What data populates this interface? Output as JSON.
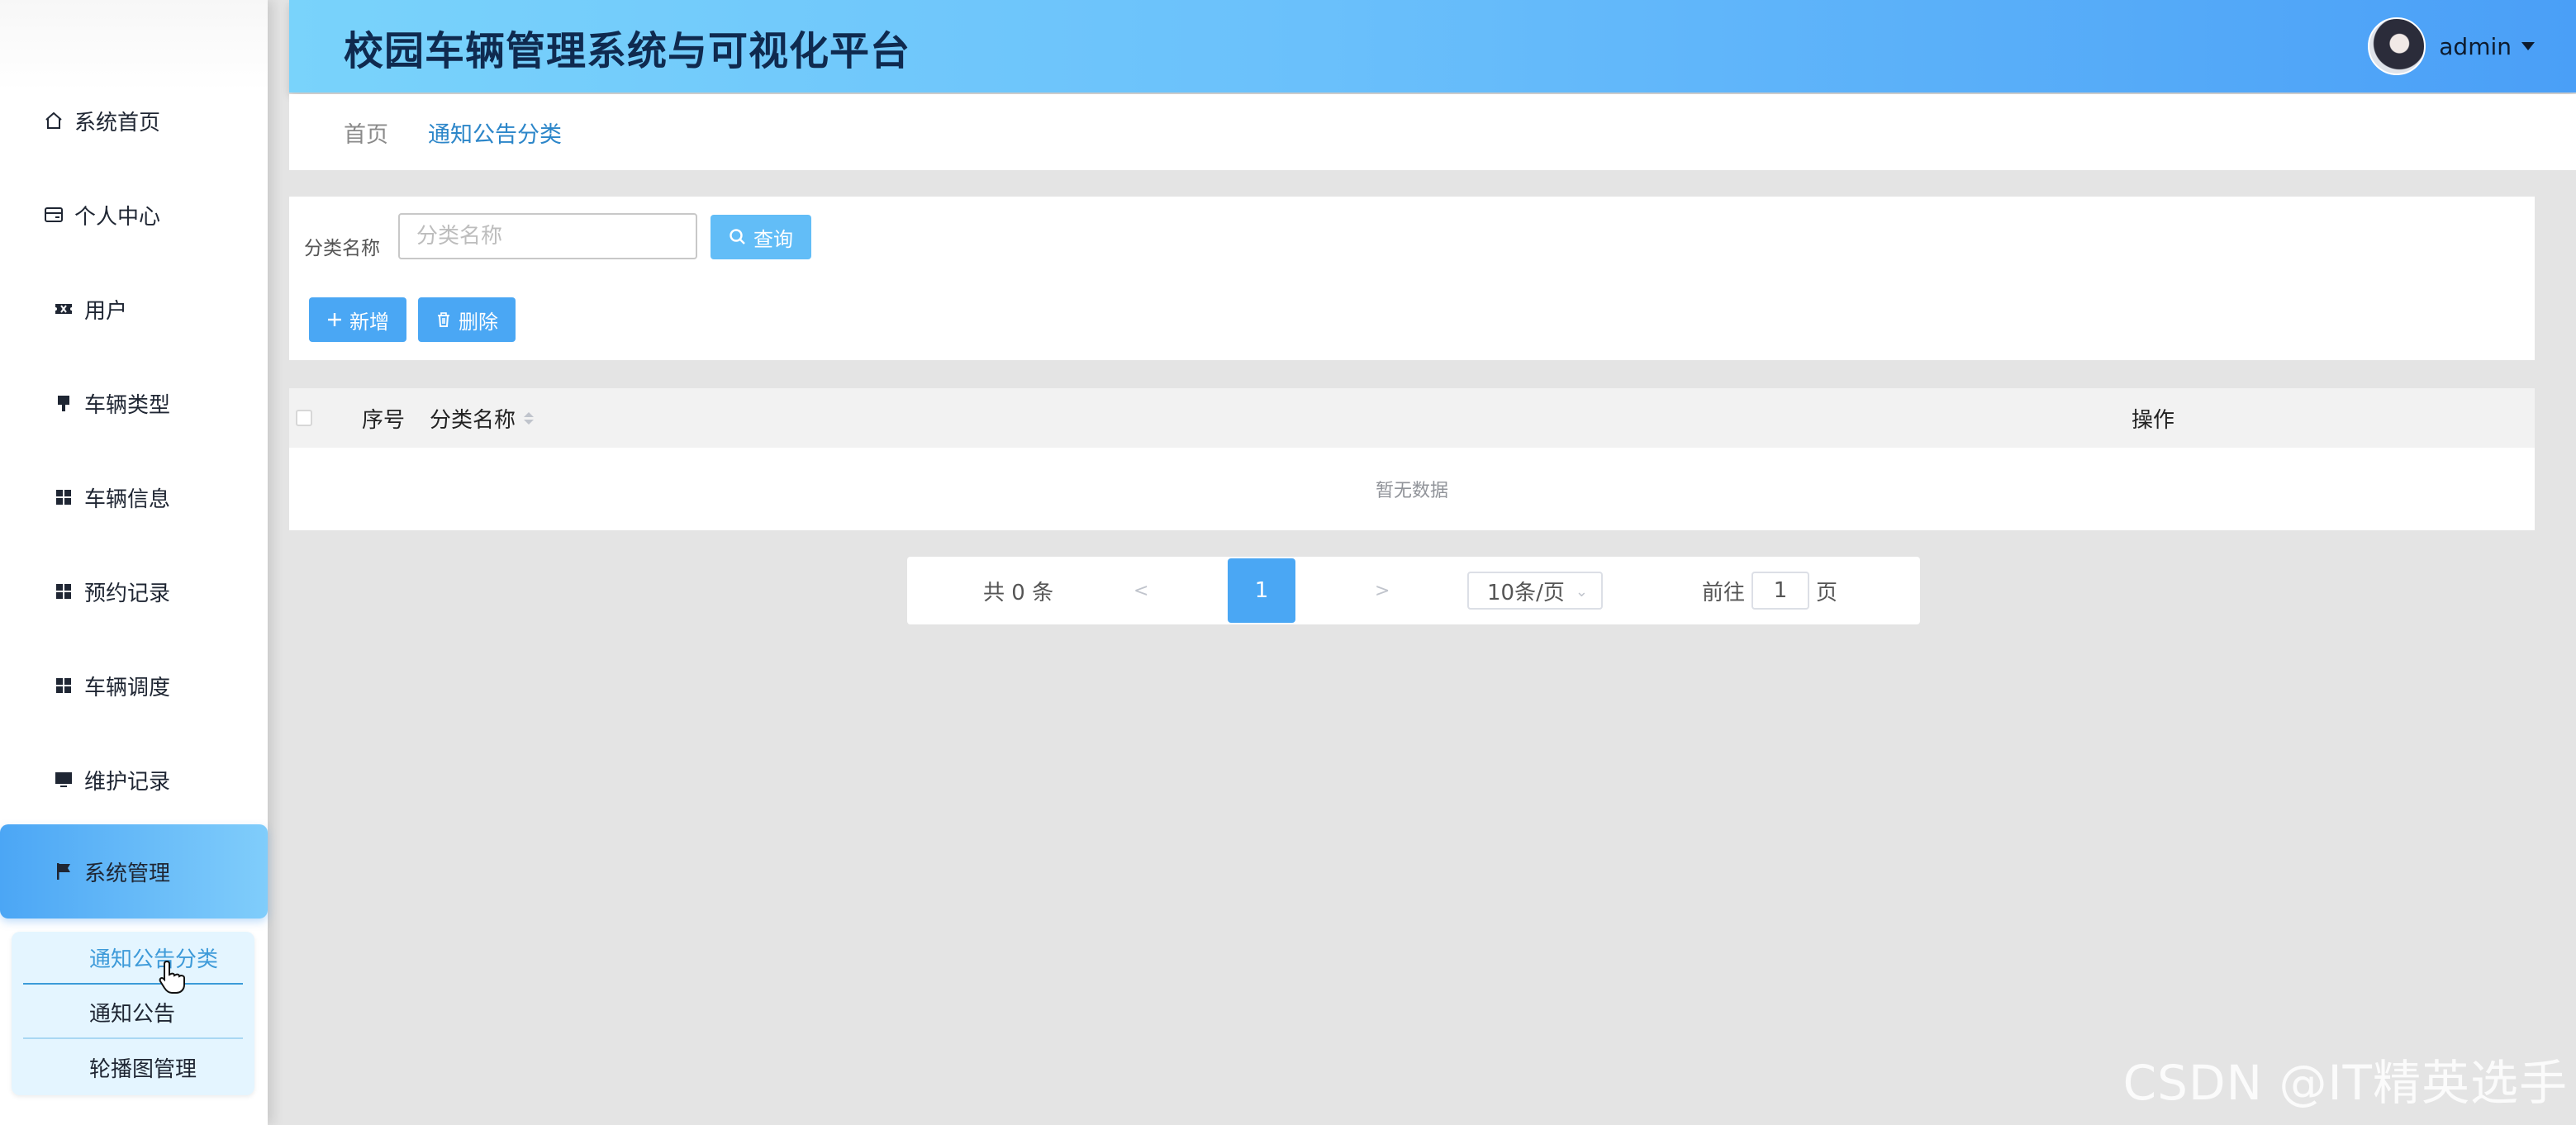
{
  "header": {
    "title": "校园车辆管理系统与可视化平台",
    "user_name": "admin"
  },
  "sidebar": {
    "items": [
      {
        "label": "系统首页",
        "icon": "home-icon"
      },
      {
        "label": "个人中心",
        "icon": "id-card-icon"
      },
      {
        "label": "用户",
        "icon": "ticket-icon"
      },
      {
        "label": "车辆类型",
        "icon": "brush-icon"
      },
      {
        "label": "车辆信息",
        "icon": "grid-icon"
      },
      {
        "label": "预约记录",
        "icon": "grid-icon"
      },
      {
        "label": "车辆调度",
        "icon": "grid-icon"
      },
      {
        "label": "维护记录",
        "icon": "monitor-icon"
      },
      {
        "label": "系统管理",
        "icon": "flag-icon",
        "active": true
      }
    ],
    "submenu": [
      {
        "label": "通知公告分类",
        "current": true
      },
      {
        "label": "通知公告"
      },
      {
        "label": "轮播图管理"
      }
    ]
  },
  "breadcrumb": {
    "home": "首页",
    "current": "通知公告分类"
  },
  "search": {
    "label": "分类名称",
    "placeholder": "分类名称",
    "query_label": "查询",
    "add_label": "新增",
    "delete_label": "删除"
  },
  "table": {
    "columns": [
      "序号",
      "分类名称",
      "操作"
    ],
    "rows": [],
    "empty_text": "暂无数据"
  },
  "pagination": {
    "total_text": "共 0 条",
    "prev": "<",
    "current_page": "1",
    "next": ">",
    "page_size": "10条/页",
    "goto_prefix": "前往",
    "goto_value": "1",
    "goto_suffix": "页"
  },
  "watermark": "CSDN @IT精英选手",
  "colors": {
    "header_gradient_start": "#79d3fb",
    "header_gradient_end": "#4a9ff7",
    "primary_button": "#4aa7f4",
    "active_menu": "#4ba6f5",
    "submenu_bg": "#e4f5ff"
  }
}
